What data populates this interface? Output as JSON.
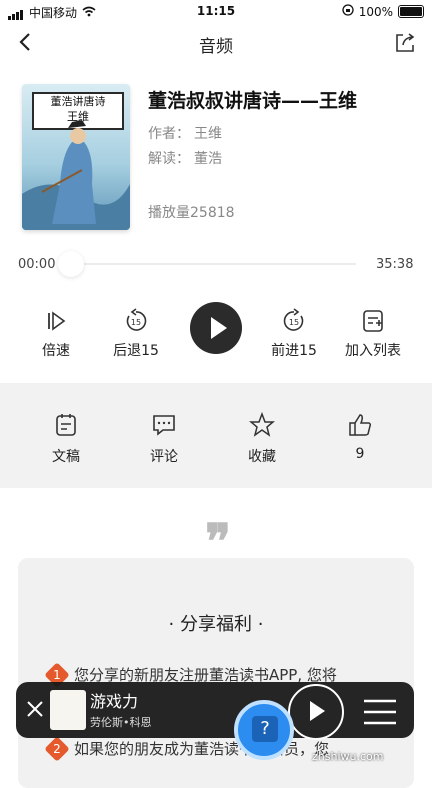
{
  "status_bar": {
    "carrier": "中国移动",
    "time": "11:15",
    "battery": "100%"
  },
  "nav": {
    "title": "音频"
  },
  "album": {
    "cover_text": "董浩讲唐诗\n王维",
    "title": "董浩叔叔讲唐诗——王维",
    "author_label": "作者：",
    "author": "王维",
    "reader_label": "解读：",
    "reader": "董浩",
    "plays": "播放量25818"
  },
  "progress": {
    "current": "00:00",
    "total": "35:38"
  },
  "controls": {
    "speed": "倍速",
    "rewind": "后退15",
    "forward": "前进15",
    "add_list": "加入列表"
  },
  "actions": {
    "transcript": "文稿",
    "comment": "评论",
    "favorite": "收藏",
    "likes": "9"
  },
  "share_card": {
    "title": "·  分享福利  ·",
    "items": [
      {
        "num": "1",
        "text": "您分享的新朋友注册董浩读书APP, 您将"
      },
      {
        "num": "2",
        "text": "如果您的朋友成为董浩读书年会员，您"
      }
    ]
  },
  "mini_player": {
    "title": "游戏力",
    "subtitle": "劳伦斯•科恩"
  },
  "help": {
    "label": "?"
  },
  "watermark": "zhshiwu.com"
}
